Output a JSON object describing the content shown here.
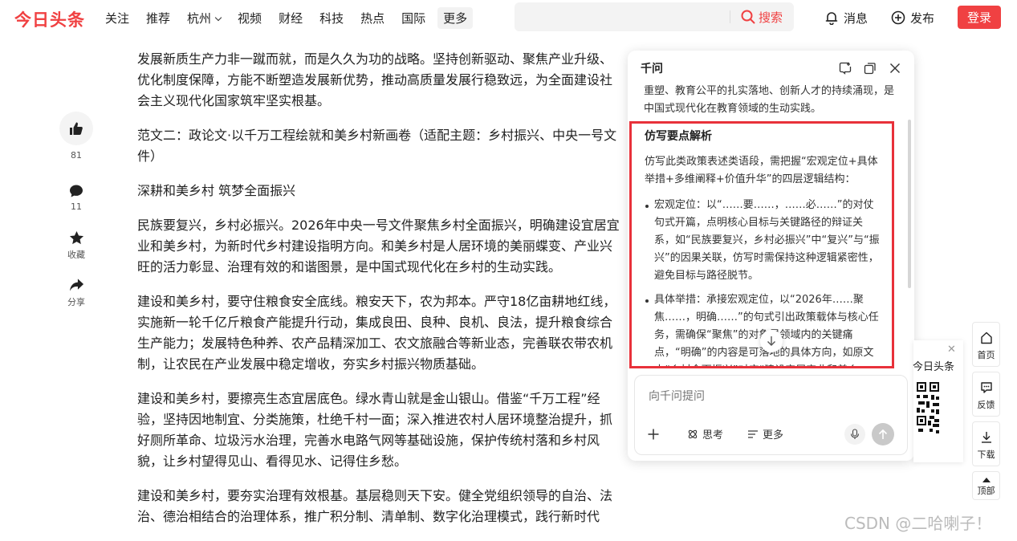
{
  "header": {
    "logo": "今日头条",
    "nav": [
      "关注",
      "推荐",
      "杭州",
      "视频",
      "财经",
      "科技",
      "热点",
      "国际"
    ],
    "nav_more": "更多",
    "search_placeholder": "",
    "search_button": "搜索",
    "messages": "消息",
    "publish": "发布",
    "login": "登录"
  },
  "sidebar_left": {
    "like_count": "81",
    "comment_count": "11",
    "favorite": "收藏",
    "share": "分享"
  },
  "article": {
    "paragraphs": [
      "发展新质生产力非一蹴而就，而是久久为功的战略。坚持创新驱动、聚焦产业升级、优化制度保障，方能不断塑造发展新优势，推动高质量发展行稳致远，为全面建设社会主义现代化国家筑牢坚实根基。",
      "范文二：政论文·以千万工程绘就和美乡村新画卷（适配主题：乡村振兴、中央一号文件）",
      "深耕和美乡村 筑梦全面振兴",
      "民族要复兴，乡村必振兴。2026年中央一号文件聚焦乡村全面振兴，明确建设宜居宜业和美乡村，为新时代乡村建设指明方向。和美乡村是人居环境的美丽蝶变、产业兴旺的活力彰显、治理有效的和谐图景，是中国式现代化在乡村的生动实践。",
      "建设和美乡村，要守住粮食安全底线。粮安天下，农为邦本。严守18亿亩耕地红线，实施新一轮千亿斤粮食产能提升行动，集成良田、良种、良机、良法，提升粮食综合生产能力；发展特色种养、农产品精深加工、农文旅融合等新业态，完善联农带农机制，让农民在产业发展中稳定增收，夯实乡村振兴物质基础。",
      "建设和美乡村，要擦亮生态宜居底色。绿水青山就是金山银山。借鉴“千万工程”经验，坚持因地制宜、分类施策，杜绝千村一面；深入推进农村人居环境整治提升，抓好厕所革命、垃圾污水治理，完善水电路气网等基础设施，保护传统村落和乡村风貌，让乡村望得见山、看得见水、记得住乡愁。",
      "建设和美乡村，要夯实治理有效根基。基层稳则天下安。健全党组织领导的自治、法治、德治相结合的治理体系，推广积分制、清单制、数字化治理模式，践行新时代"
    ]
  },
  "assistant": {
    "title": "千问",
    "top_text": "重塑、教育公平的扎实落地、创新人才的持续涌现，是中国式现代化在教育领域的生动实践。",
    "section_title": "仿写要点解析",
    "intro": "仿写此类政策表述类语段，需把握“宏观定位+具体举措+多维阐释+价值升华”的四层逻辑结构：",
    "bullets": [
      "宏观定位：以“……要……，……必……”的对仗句式开篇，点明核心目标与关键路径的辩证关系，如“民族要复兴，乡村必振兴”中“复兴”与“振兴”的因果关联，仿写时需保持这种逻辑紧密性，避免目标与路径脱节。",
      "具体举措：承接宏观定位，以“2026年……聚焦……，明确……”的句式引出政策载体与核心任务，需确保“聚焦”的对象是领域内的关键痛点，“明确”的内容是可落地的具体方向，如原文中“乡村全面振兴”对应“建设宜居宜业和美乡村”，仿写时“高水平科技自立自强”"
    ],
    "input_placeholder": "向千问提问",
    "tool_think": "思考",
    "tool_more": "更多"
  },
  "qr_card": {
    "title": "今日头条"
  },
  "float_bar": {
    "home": "首页",
    "feedback": "反馈",
    "download": "下载",
    "top": "顶部"
  },
  "watermark": "CSDN @二哈喇子！",
  "colors": {
    "brand_red": "#f04142",
    "highlight_border": "#e8313a"
  }
}
